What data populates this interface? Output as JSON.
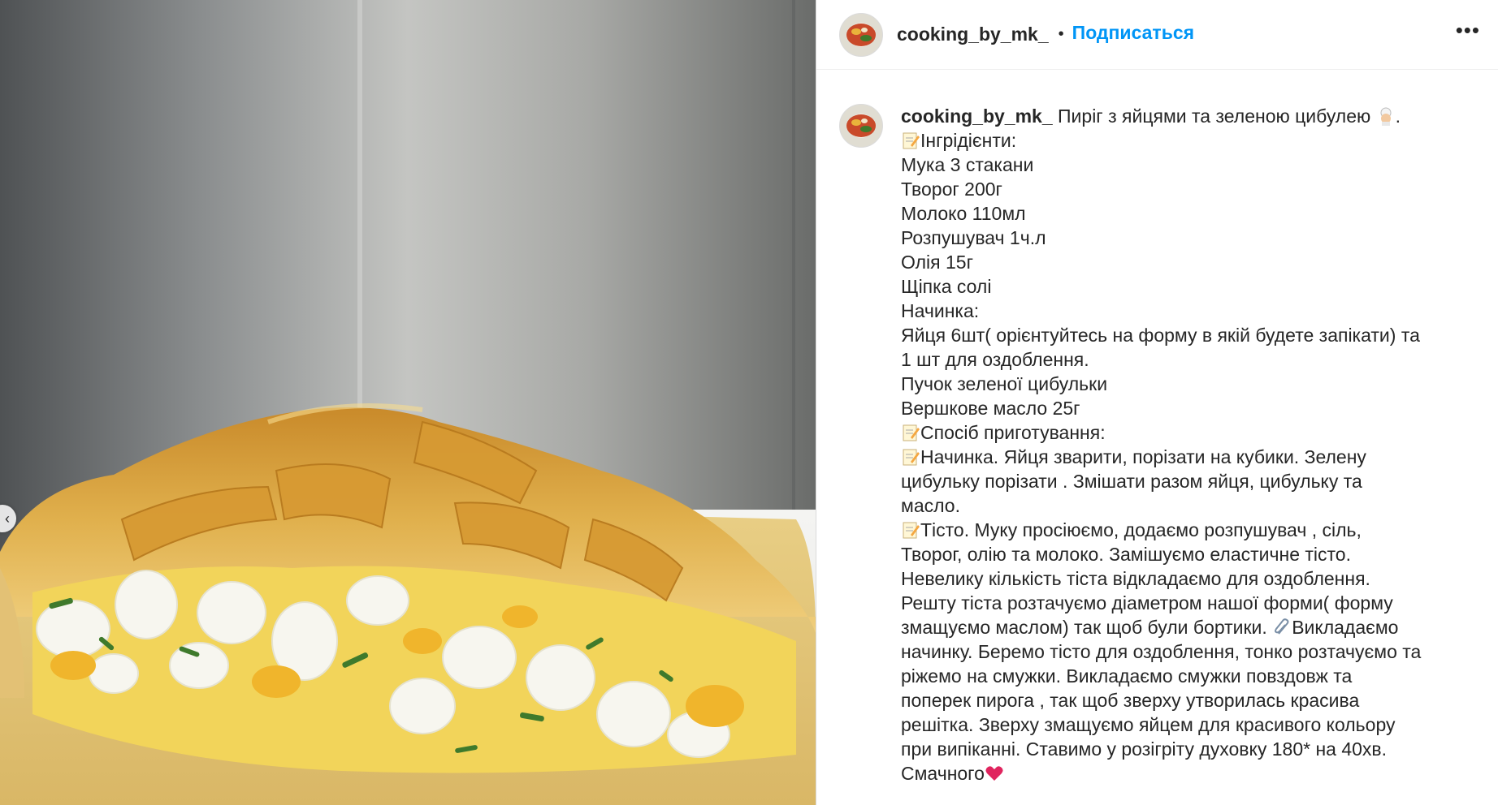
{
  "header": {
    "username": "cooking_by_mk_",
    "separator": "•",
    "follow_label": "Подписаться",
    "more_label": "•••"
  },
  "photo": {
    "prev_arrow": "‹"
  },
  "caption": {
    "username": "cooking_by_mk_",
    "title": " Пиріг з яйцями та зеленою цибулею",
    "title_end": ".",
    "lines": [
      "Інгрідієнти:",
      "Мука 3 стакани",
      "Творог 200г",
      "Молоко 110мл",
      "Розпушувач 1ч.л",
      "Олія 15г",
      "Щіпка солі",
      "Начинка:",
      "Яйця 6шт( орієнтуйтесь на форму в якій будете запікати) та",
      "1 шт для оздоблення.",
      "Пучок зеленої цибульки",
      "Вершкове масло 25г",
      "Спосіб приготування:",
      "Начинка. Яйця зварити, порізати на кубики. Зелену",
      "цибульку порізати . Змішати разом яйця, цибульку та",
      "масло.",
      "Тісто. Муку просіюємо, додаємо розпушувач , сіль,",
      "Творог, олію та молоко. Замішуємо еластичне тісто.",
      "Невелику кількість тіста відкладаємо для оздоблення.",
      "Решту тіста розтачуємо діаметром нашої форми( форму",
      "змащуємо маслом) так щоб були бортики. ",
      "Викладаємо",
      "начинку. Беремо тісто для оздоблення, тонко розтачуємо та",
      "ріжемо на смужки. Викладаємо смужки повздовж та",
      "поперек пирога , так щоб зверху утворилась красива",
      "решітка. Зверху змащуємо яйцем для красивого кольору",
      "при випіканні. Ставимо у розігріту духовку 180* на 40хв.",
      "Смачного"
    ],
    "icons": {
      "memo": "memo-icon",
      "chef": "chef-icon",
      "paperclip": "paperclip-icon",
      "heart": "red-heart-icon"
    }
  },
  "colors": {
    "follow": "#0095f6",
    "text": "#262626",
    "heart": "#e0245e"
  }
}
